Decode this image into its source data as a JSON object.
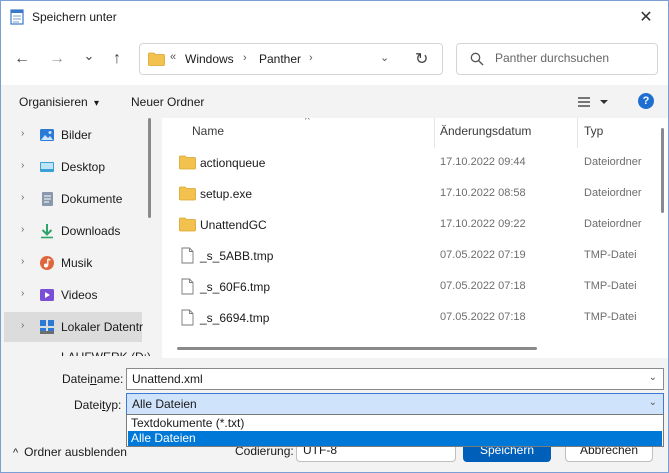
{
  "window": {
    "title": "Speichern unter",
    "close_glyph": "✕"
  },
  "nav": {
    "back": "←",
    "forward": "→",
    "recent": "⌄",
    "up": "↑",
    "breadcrumb_prefix": "«",
    "crumbs": [
      "Windows",
      "Panther"
    ],
    "crumb_sep": "›",
    "dropdown": "⌄",
    "refresh": "↻",
    "search_placeholder": "Panther durchsuchen"
  },
  "toolbar": {
    "organize": "Organisieren",
    "organize_caret": "▾",
    "new_folder": "Neuer Ordner",
    "help": "?"
  },
  "sidebar": {
    "items": [
      {
        "label": "Bilder",
        "icon": "pictures-icon",
        "color": "#2b7ad6"
      },
      {
        "label": "Desktop",
        "icon": "desktop-icon",
        "color": "#3aa0d8"
      },
      {
        "label": "Dokumente",
        "icon": "documents-icon",
        "color": "#6b7c93"
      },
      {
        "label": "Downloads",
        "icon": "downloads-icon",
        "color": "#2ea36b"
      },
      {
        "label": "Musik",
        "icon": "music-icon",
        "color": "#e0673d"
      },
      {
        "label": "Videos",
        "icon": "videos-icon",
        "color": "#7a4fd6"
      },
      {
        "label": "Lokaler Datentr",
        "icon": "local-drive-icon",
        "color": "#2b7ad6"
      }
    ],
    "cut_item": "LAUFWERK (D:)",
    "expander": "›"
  },
  "list": {
    "columns": {
      "name": "Name",
      "date": "Änderungsdatum",
      "type": "Typ"
    },
    "sort_caret": "^",
    "rows": [
      {
        "name": "actionqueue",
        "date": "17.10.2022 09:44",
        "type": "Dateiordner",
        "kind": "folder"
      },
      {
        "name": "setup.exe",
        "date": "17.10.2022 08:58",
        "type": "Dateiordner",
        "kind": "folder"
      },
      {
        "name": "UnattendGC",
        "date": "17.10.2022 09:22",
        "type": "Dateiordner",
        "kind": "folder"
      },
      {
        "name": "_s_5ABB.tmp",
        "date": "07.05.2022 07:19",
        "type": "TMP-Datei",
        "kind": "file"
      },
      {
        "name": "_s_60F6.tmp",
        "date": "07.05.2022 07:18",
        "type": "TMP-Datei",
        "kind": "file"
      },
      {
        "name": "_s_6694.tmp",
        "date": "07.05.2022 07:18",
        "type": "TMP-Datei",
        "kind": "file"
      }
    ]
  },
  "form": {
    "filename_label_pre": "Datei",
    "filename_label_ul": "n",
    "filename_label_post": "ame:",
    "filename_value": "Unattend.xml",
    "filetype_label_pre": "Datei",
    "filetype_label_ul": "t",
    "filetype_label_post": "yp:",
    "filetype_value": "Alle Dateien",
    "filetype_options": [
      "Textdokumente (*.txt)",
      "Alle Dateien"
    ],
    "dropdown_caret": "⌄",
    "hide_folders": "Ordner ausblenden",
    "hide_caret": "^",
    "encoding_label": "Codierung:",
    "encoding_value": "UTF-8",
    "save": "Speichern",
    "cancel": "Abbrechen"
  },
  "colors": {
    "accent": "#0078d7",
    "folder": "#f2c14e",
    "selection_bg": "#cfe3fb"
  }
}
